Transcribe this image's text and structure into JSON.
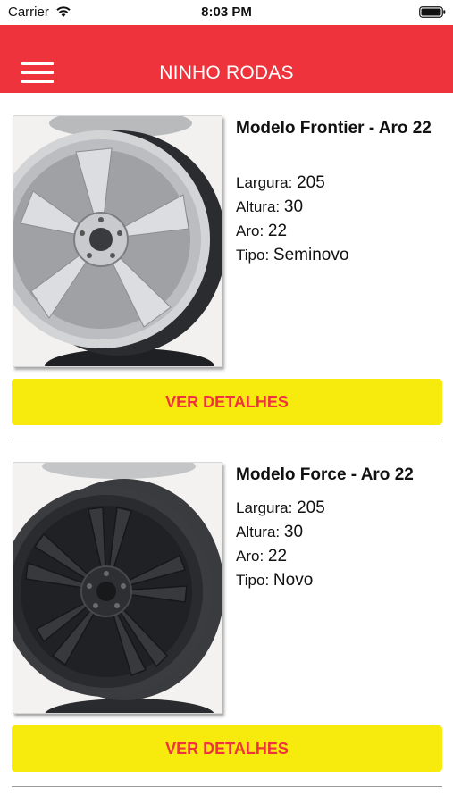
{
  "status_bar": {
    "carrier": "Carrier",
    "time": "8:03 PM"
  },
  "header": {
    "title": "NINHO RODAS",
    "menu_icon": "hamburger-menu-icon",
    "color": "#ee333c"
  },
  "products": [
    {
      "name": "Modelo Frontier - Aro 22",
      "specs": [
        {
          "label": "Largura:",
          "value": "205"
        },
        {
          "label": "Altura:",
          "value": "30"
        },
        {
          "label": "Aro:",
          "value": "22"
        },
        {
          "label": "Tipo:",
          "value": "Seminovo"
        }
      ],
      "button_label": "VER DETALHES",
      "wheel_color": "#c6c7c9"
    },
    {
      "name": "Modelo Force - Aro 22",
      "specs": [
        {
          "label": "Largura:",
          "value": "205"
        },
        {
          "label": "Altura:",
          "value": "30"
        },
        {
          "label": "Aro:",
          "value": "22"
        },
        {
          "label": "Tipo:",
          "value": "Novo"
        }
      ],
      "button_label": "VER DETALHES",
      "wheel_color": "#2e2f33"
    }
  ],
  "colors": {
    "button_bg": "#f7ea0d",
    "button_text": "#ee333c"
  }
}
